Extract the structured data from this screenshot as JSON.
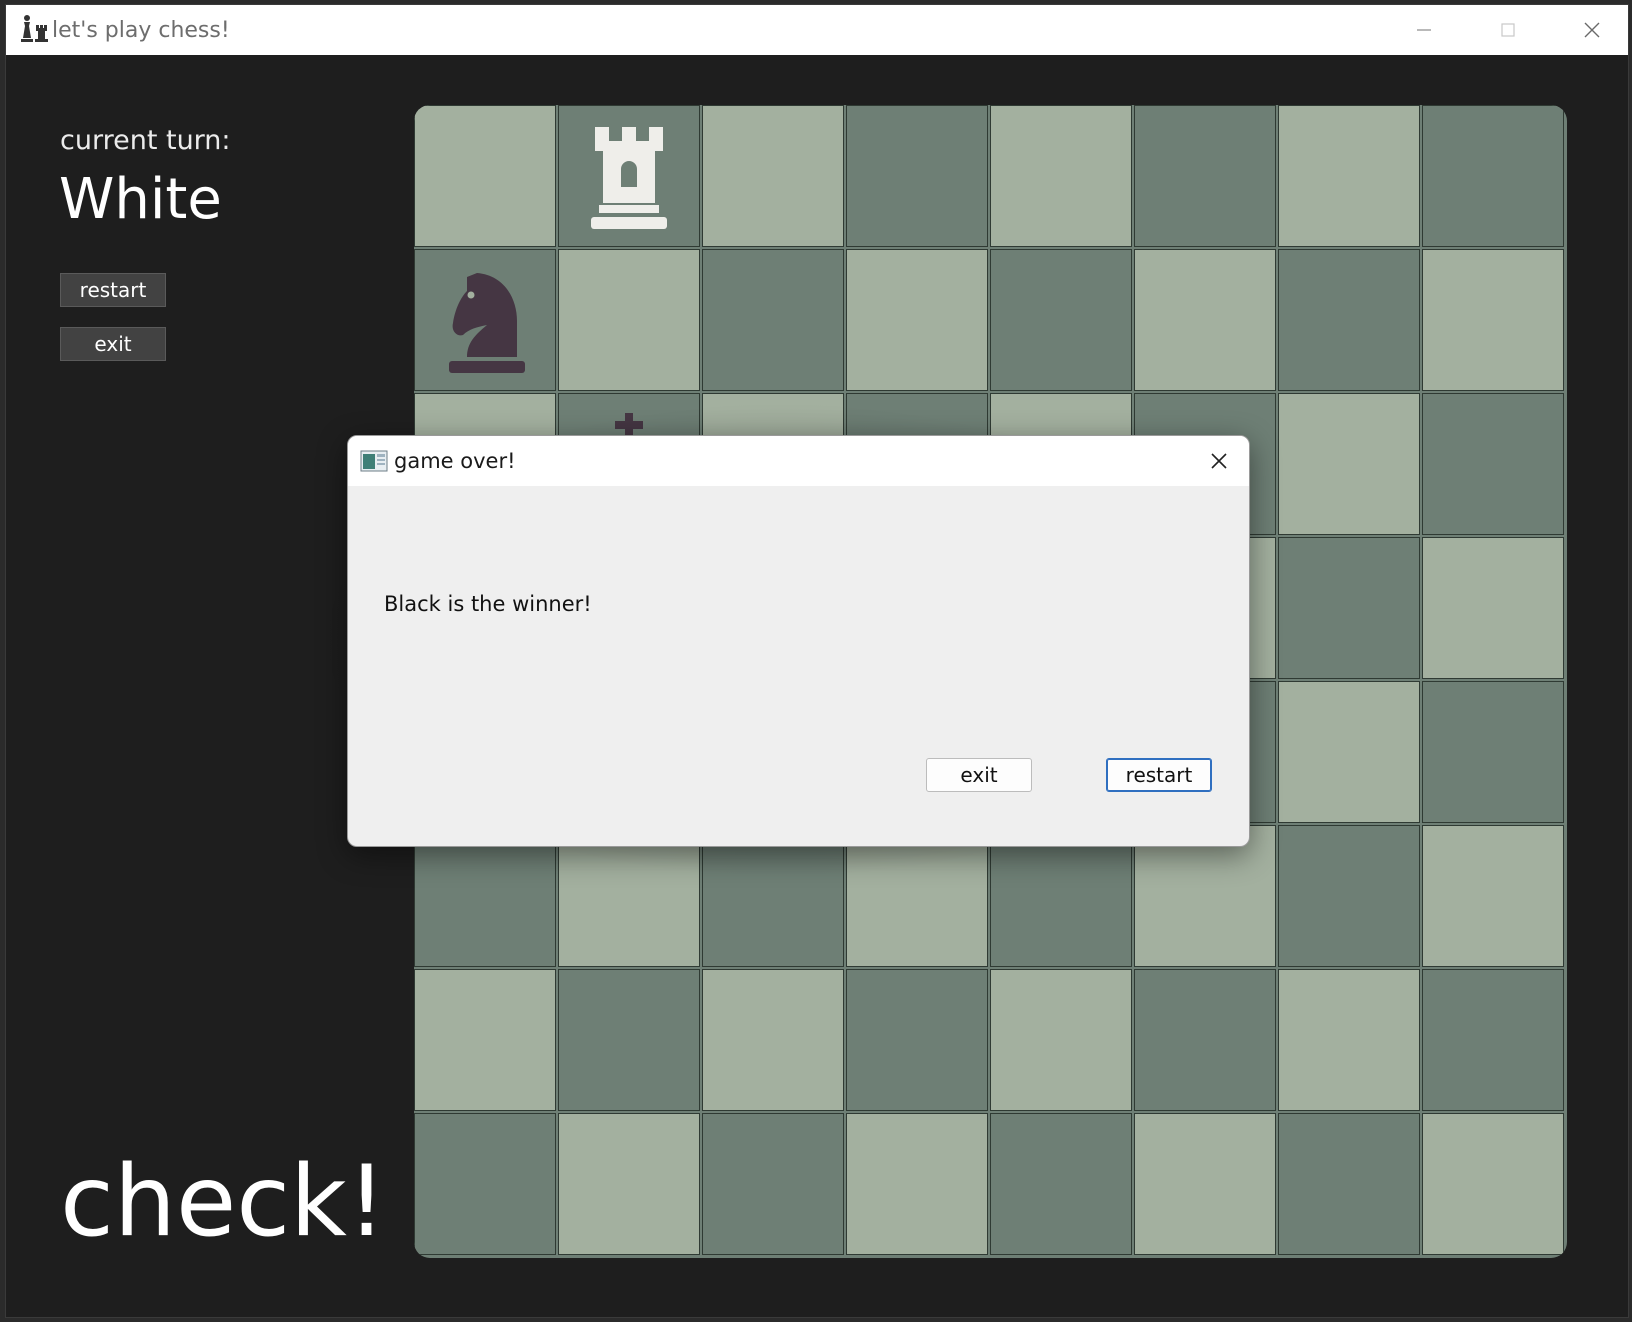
{
  "window": {
    "title": "let's play chess!"
  },
  "sidebar": {
    "turn_label": "current turn:",
    "turn_value": "White",
    "restart_label": "restart",
    "exit_label": "exit",
    "status_text": "check!"
  },
  "board": {
    "light_color": "#a3b09f",
    "dark_color": "#6e7f75",
    "pieces": [
      {
        "row": 0,
        "col": 1,
        "type": "rook",
        "color": "white"
      },
      {
        "row": 1,
        "col": 0,
        "type": "knight",
        "color": "black"
      },
      {
        "row": 2,
        "col": 1,
        "type": "king",
        "color": "black"
      }
    ]
  },
  "dialog": {
    "title": "game over!",
    "message": "Black is the winner!",
    "exit_label": "exit",
    "restart_label": "restart"
  }
}
